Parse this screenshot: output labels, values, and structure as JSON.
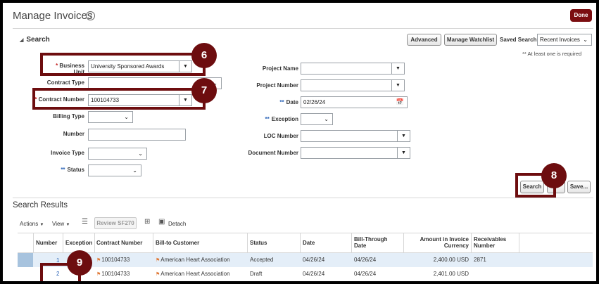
{
  "page": {
    "title": "Manage Invoices",
    "help_icon": "?",
    "done_label": "Done"
  },
  "search": {
    "heading": "Search",
    "advanced_label": "Advanced",
    "manage_watchlist_label": "Manage Watchlist",
    "saved_search_label": "Saved Search",
    "saved_search_value": "Recent Invoices",
    "required_note": "** At least one is required",
    "fields": {
      "business_unit": {
        "label": "Business Unit",
        "value": "University Sponsored Awards"
      },
      "contract_type": {
        "label": "Contract Type",
        "value": ""
      },
      "contract_number": {
        "label": "Contract Number",
        "value": "100104733"
      },
      "billing_type": {
        "label": "Billing Type",
        "value": ""
      },
      "number": {
        "label": "Number",
        "value": ""
      },
      "invoice_type": {
        "label": "Invoice Type",
        "value": ""
      },
      "status": {
        "label": "Status",
        "value": ""
      },
      "project_name": {
        "label": "Project Name",
        "value": ""
      },
      "project_number": {
        "label": "Project Number",
        "value": ""
      },
      "date": {
        "label": "Date",
        "value": "02/26/24"
      },
      "exception": {
        "label": "Exception",
        "value": ""
      },
      "loc_number": {
        "label": "LOC Number",
        "value": ""
      },
      "document_number": {
        "label": "Document Number",
        "value": ""
      }
    },
    "search_label": "Search",
    "save_label": "Save..."
  },
  "callouts": {
    "c6": "6",
    "c7": "7",
    "c8": "8",
    "c9": "9"
  },
  "results": {
    "title": "Search Results",
    "toolbar": {
      "actions": "Actions",
      "view": "View",
      "review": "Review SF270",
      "detach": "Detach"
    },
    "columns": {
      "number": "Number",
      "exception": "Exception",
      "contract_number": "Contract Number",
      "bill_to": "Bill-to Customer",
      "status": "Status",
      "date": "Date",
      "bill_through_1": "Bill-Through",
      "bill_through_2": "Date",
      "amount_1": "Amount in Invoice",
      "amount_2": "Currency",
      "receivables_1": "Receivables",
      "receivables_2": "Number"
    },
    "rows": [
      {
        "number": "1",
        "contract": "100104733",
        "customer": "American Heart Association",
        "status": "Accepted",
        "date": "04/26/24",
        "bill_through": "04/26/24",
        "amount": "2,400.00 USD",
        "receivables": "2871"
      },
      {
        "number": "2",
        "contract": "100104733",
        "customer": "American Heart Association",
        "status": "Draft",
        "date": "04/26/24",
        "bill_through": "04/26/24",
        "amount": "2,401.00 USD",
        "receivables": ""
      }
    ]
  }
}
